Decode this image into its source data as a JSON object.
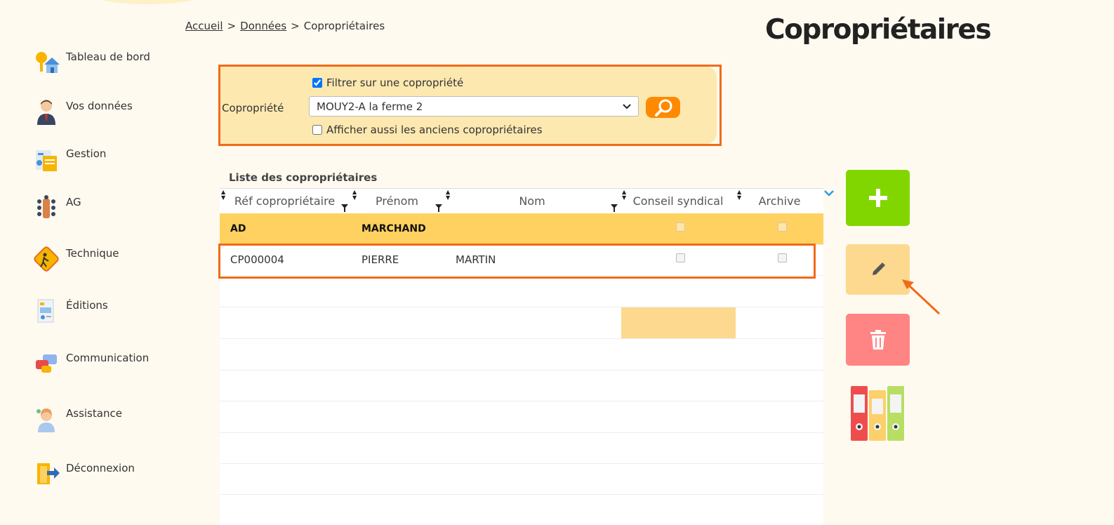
{
  "breadcrumb": {
    "home": "Accueil",
    "data": "Données",
    "current": "Copropriétaires",
    "separator": ">"
  },
  "page_title": "Copropriétaires",
  "sidebar": {
    "items": [
      {
        "label": "Tableau de bord",
        "icon": "dashboard-house-icon"
      },
      {
        "label": "Vos données",
        "icon": "user-avatar-icon"
      },
      {
        "label": "Gestion",
        "icon": "management-icon"
      },
      {
        "label": "AG",
        "icon": "meeting-table-icon"
      },
      {
        "label": "Technique",
        "icon": "worker-sign-icon"
      },
      {
        "label": "Éditions",
        "icon": "report-document-icon"
      },
      {
        "label": "Communication",
        "icon": "chat-bubbles-icon"
      },
      {
        "label": "Assistance",
        "icon": "support-agent-icon"
      },
      {
        "label": "Déconnexion",
        "icon": "logout-door-icon"
      }
    ]
  },
  "filter": {
    "filter_checkbox_label": "Filtrer sur une copropriété",
    "filter_checked": true,
    "copro_label": "Copropriété",
    "selected_copro": "MOUY2-A la ferme 2",
    "former_owners_label": "Afficher aussi les anciens copropriétaires",
    "former_owners_checked": false
  },
  "table": {
    "title": "Liste des copropriétaires",
    "columns": {
      "ref": "Réf copropriétaire",
      "firstname": "Prénom",
      "lastname": "Nom",
      "council": "Conseil syndical",
      "archive": "Archive"
    },
    "rows": [
      {
        "ref": "AD",
        "firstname": "MARCHAND",
        "lastname": "",
        "council": false,
        "archive": false,
        "selected": true
      },
      {
        "ref": "CP000004",
        "firstname": "PIERRE",
        "lastname": "MARTIN",
        "council": false,
        "archive": false,
        "selected": false
      }
    ]
  },
  "actions": {
    "add_icon": "plus-icon",
    "edit_icon": "pencil-icon",
    "delete_icon": "trash-icon",
    "archive_icon": "binders-icon"
  },
  "colors": {
    "accent_orange": "#f06a1a",
    "add_green": "#82d600",
    "edit_yellow": "#fcd98f",
    "delete_red": "#ff8585",
    "selected_row": "#ffd160"
  }
}
